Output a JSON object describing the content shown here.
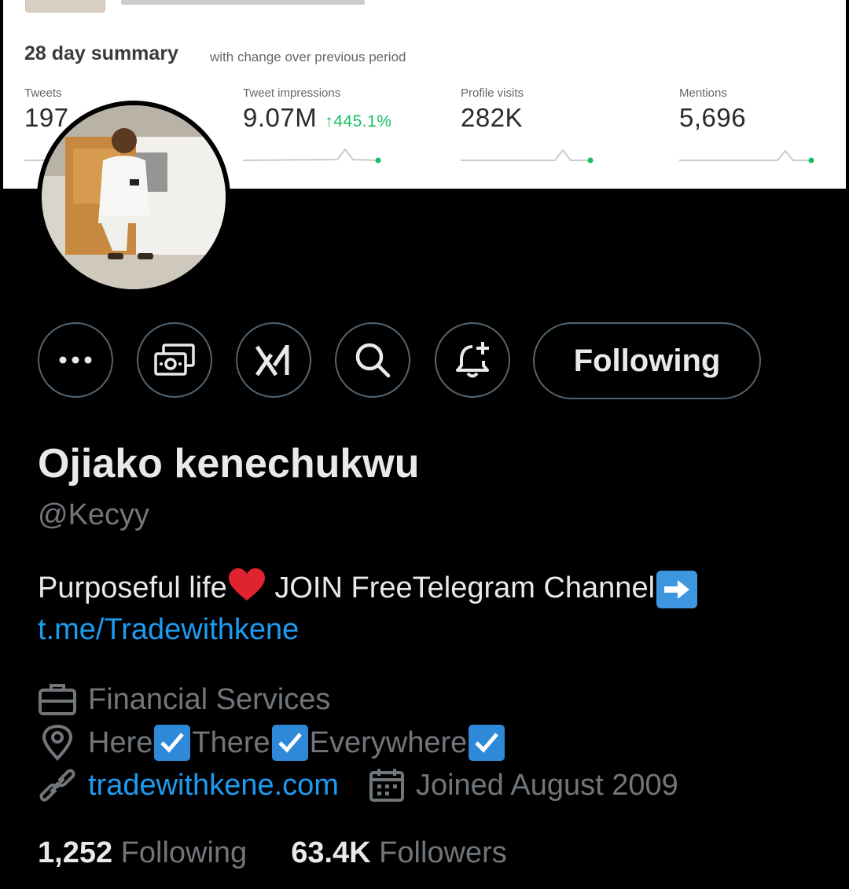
{
  "summary_card": {
    "title": "28 day summary",
    "subtitle": "with change over previous period",
    "metrics": [
      {
        "label": "Tweets",
        "value": "197",
        "change": ""
      },
      {
        "label": "Tweet impressions",
        "value": "9.07M",
        "change": "445.1%"
      },
      {
        "label": "Profile visits",
        "value": "282K",
        "change": ""
      },
      {
        "label": "Mentions",
        "value": "5,696",
        "change": ""
      }
    ],
    "accent_color": "#17bf63"
  },
  "actions": {
    "more_icon": "more-horizontal-icon",
    "tip_icon": "money-icon",
    "grok_icon": "grok-icon",
    "search_icon": "search-icon",
    "notify_icon": "bell-plus-icon",
    "following_label": "Following"
  },
  "profile": {
    "name": "Ojiako kenechukwu",
    "handle": "@Kecyy",
    "bio_text": "Purposeful life",
    "bio_text_2": " JOIN FreeTelegram Channel",
    "bio_link": "t.me/Tradewithkene",
    "category": "Financial Services",
    "location_parts": [
      "Here",
      "There",
      "Everywhere"
    ],
    "website": "tradewithkene.com",
    "joined": "Joined August 2009",
    "following_count": "1,252",
    "following_label": "Following",
    "followers_count": "63.4K",
    "followers_label": "Followers"
  },
  "colors": {
    "background": "#000000",
    "primary_text": "#e7e9ea",
    "secondary_text": "#71767b",
    "link": "#1d9bf0",
    "border": "#536471"
  }
}
